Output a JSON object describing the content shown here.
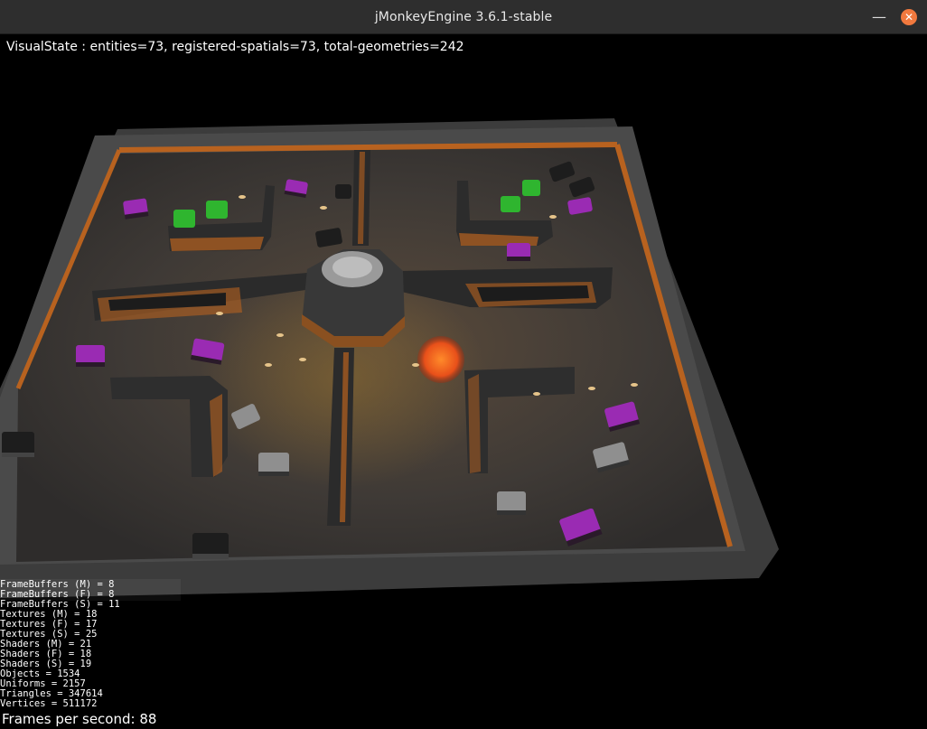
{
  "window": {
    "title": "jMonkeyEngine 3.6.1-stable",
    "minimize_symbol": "—",
    "close_symbol": "✕"
  },
  "hud": {
    "visual_state": "VisualState : entities=73, registered-spatials=73, total-geometries=242",
    "fps": "Frames per second: 88",
    "stats": [
      "FrameBuffers (M) = 8",
      "FrameBuffers (F) = 8",
      "FrameBuffers (S) = 11",
      "Textures (M) = 18",
      "Textures (F) = 17",
      "Textures (S) = 25",
      "Shaders (M) = 21",
      "Shaders (F) = 18",
      "Shaders (S) = 19",
      "Objects = 1534",
      "Uniforms = 2157",
      "Triangles = 347614",
      "Vertices = 511172"
    ]
  },
  "scene": {
    "tank_colors": {
      "purple": "#9a2bb3",
      "green": "#2fb52f",
      "black": "#1d1d1d",
      "gray": "#8f8f8f"
    },
    "wall_trim_color": "#b8621f",
    "explosion_color": "#f05a14"
  }
}
